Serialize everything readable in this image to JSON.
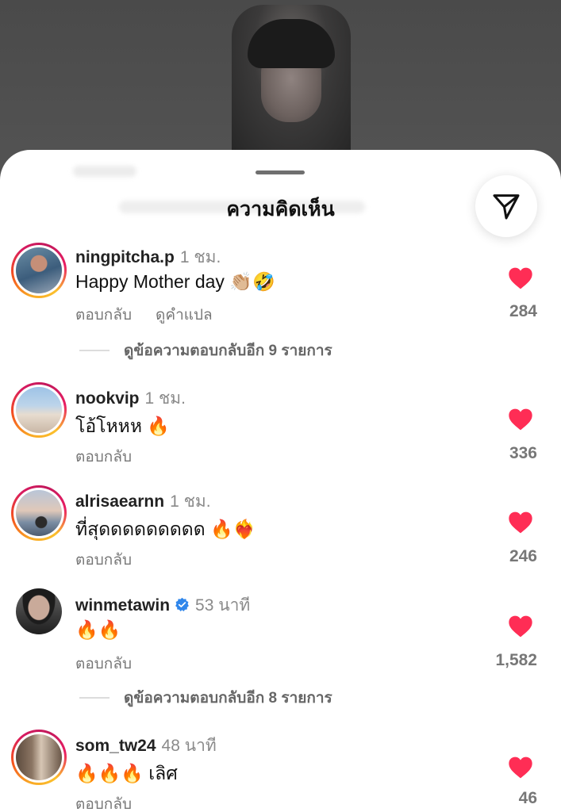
{
  "sheet": {
    "title": "ความคิดเห็น"
  },
  "comments": [
    {
      "username": "ningpitcha.p",
      "time": "1 ชม.",
      "text": "Happy Mother day 👏🏼🤣",
      "reply_label": "ตอบกลับ",
      "translate_label": "ดูคำแปล",
      "likes": "284",
      "story_ring": true,
      "verified": false,
      "view_replies": "ดูข้อความตอบกลับอีก 9 รายการ"
    },
    {
      "username": "nookvip",
      "time": "1 ชม.",
      "text": "โอ้โหหห 🔥",
      "reply_label": "ตอบกลับ",
      "likes": "336",
      "story_ring": true,
      "verified": false
    },
    {
      "username": "alrisaearnn",
      "time": "1 ชม.",
      "text": "ที่สุดดดดดดดดด 🔥❤️‍🔥",
      "reply_label": "ตอบกลับ",
      "likes": "246",
      "story_ring": true,
      "verified": false
    },
    {
      "username": "winmetawin",
      "time": "53 นาที",
      "text": "🔥🔥",
      "reply_label": "ตอบกลับ",
      "likes": "1,582",
      "story_ring": false,
      "verified": true,
      "view_replies": "ดูข้อความตอบกลับอีก 8 รายการ"
    },
    {
      "username": "som_tw24",
      "time": "48 นาที",
      "text": "🔥🔥🔥 เลิศ",
      "reply_label": "ตอบกลับ",
      "likes": "46",
      "story_ring": true,
      "verified": false
    }
  ],
  "icons": {
    "heart": "heart-icon",
    "share": "send-icon",
    "verified": "verified-badge-icon"
  },
  "colors": {
    "heart": "#ff2d55",
    "verified": "#2f86eb"
  }
}
